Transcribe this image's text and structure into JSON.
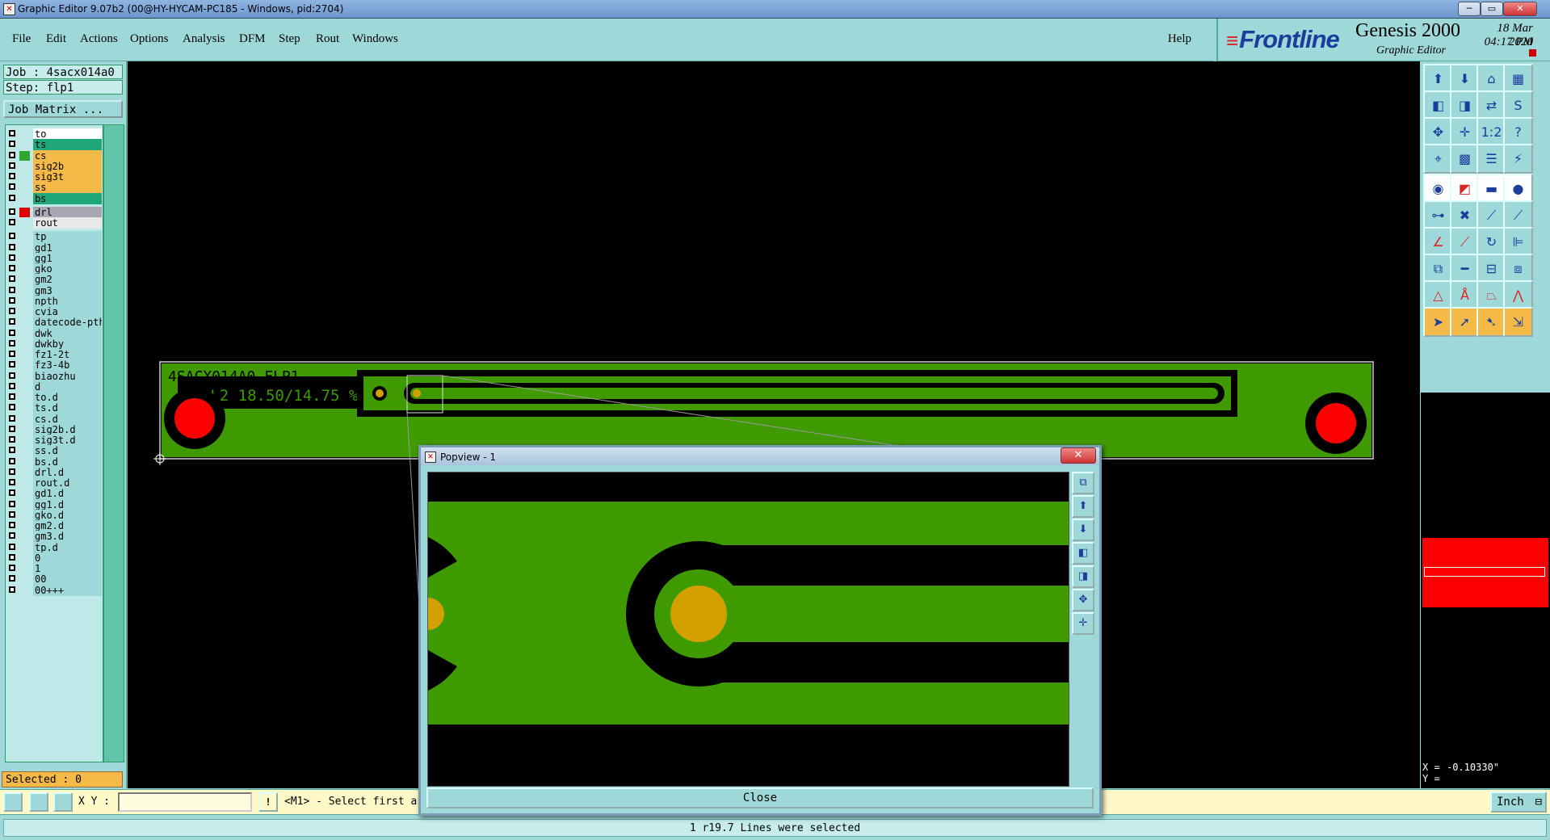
{
  "window": {
    "title": "Graphic Editor 9.07b2 (00@HY-HYCAM-PC185 - Windows, pid:2704)",
    "minimize_icon": "minimize-icon",
    "maximize_icon": "maximize-icon",
    "close_icon": "close-icon",
    "min_label": "─",
    "max_label": "▭",
    "close_label": "✕"
  },
  "menu": [
    "File",
    "Edit",
    "Actions",
    "Options",
    "Analysis",
    "DFM",
    "Step",
    "Rout",
    "Windows"
  ],
  "help_label": "Help",
  "brand": {
    "logo": "Frontline",
    "product": "Genesis 2000",
    "subtitle": "Graphic Editor",
    "date": "18 Mar 2020",
    "time": "04:17 PM"
  },
  "job": {
    "job_label": "Job : 4sacx014a0",
    "step_label": "Step: flp1",
    "job_matrix_button": "Job Matrix ..."
  },
  "layers": [
    {
      "name": "to",
      "color": "#ffffff",
      "swatch": ""
    },
    {
      "name": "ts",
      "color": "#1fa67a",
      "swatch": ""
    },
    {
      "name": "cs",
      "color": "#f5b947",
      "swatch": "#2fa82f"
    },
    {
      "name": "sig2b",
      "color": "#f5b947",
      "swatch": ""
    },
    {
      "name": "sig3t",
      "color": "#f5b947",
      "swatch": ""
    },
    {
      "name": "ss",
      "color": "#f5b947",
      "swatch": ""
    },
    {
      "name": "bs",
      "color": "#1fa67a",
      "swatch": ""
    },
    {
      "name": "drl",
      "color": "#a8a8b4",
      "swatch": "#e00000"
    },
    {
      "name": "rout",
      "color": "#e8e8e8",
      "swatch": ""
    },
    {
      "name": "tp",
      "color": "#9fd8d8",
      "swatch": ""
    },
    {
      "name": "gd1",
      "color": "#9fd8d8",
      "swatch": ""
    },
    {
      "name": "gg1",
      "color": "#9fd8d8",
      "swatch": ""
    },
    {
      "name": "gko",
      "color": "#9fd8d8",
      "swatch": ""
    },
    {
      "name": "gm2",
      "color": "#9fd8d8",
      "swatch": ""
    },
    {
      "name": "gm3",
      "color": "#9fd8d8",
      "swatch": ""
    },
    {
      "name": "npth",
      "color": "#9fd8d8",
      "swatch": ""
    },
    {
      "name": "cvia",
      "color": "#9fd8d8",
      "swatch": ""
    },
    {
      "name": "datecode-pth",
      "color": "#9fd8d8",
      "swatch": ""
    },
    {
      "name": "dwk",
      "color": "#9fd8d8",
      "swatch": ""
    },
    {
      "name": "dwkby",
      "color": "#9fd8d8",
      "swatch": ""
    },
    {
      "name": "fz1-2t",
      "color": "#9fd8d8",
      "swatch": ""
    },
    {
      "name": "fz3-4b",
      "color": "#9fd8d8",
      "swatch": ""
    },
    {
      "name": "biaozhu",
      "color": "#9fd8d8",
      "swatch": ""
    },
    {
      "name": "d",
      "color": "#9fd8d8",
      "swatch": ""
    },
    {
      "name": "to.d",
      "color": "#9fd8d8",
      "swatch": ""
    },
    {
      "name": "ts.d",
      "color": "#9fd8d8",
      "swatch": ""
    },
    {
      "name": "cs.d",
      "color": "#9fd8d8",
      "swatch": ""
    },
    {
      "name": "sig2b.d",
      "color": "#9fd8d8",
      "swatch": ""
    },
    {
      "name": "sig3t.d",
      "color": "#9fd8d8",
      "swatch": ""
    },
    {
      "name": "ss.d",
      "color": "#9fd8d8",
      "swatch": ""
    },
    {
      "name": "bs.d",
      "color": "#9fd8d8",
      "swatch": ""
    },
    {
      "name": "drl.d",
      "color": "#9fd8d8",
      "swatch": ""
    },
    {
      "name": "rout.d",
      "color": "#9fd8d8",
      "swatch": ""
    },
    {
      "name": "gd1.d",
      "color": "#9fd8d8",
      "swatch": ""
    },
    {
      "name": "gg1.d",
      "color": "#9fd8d8",
      "swatch": ""
    },
    {
      "name": "gko.d",
      "color": "#9fd8d8",
      "swatch": ""
    },
    {
      "name": "gm2.d",
      "color": "#9fd8d8",
      "swatch": ""
    },
    {
      "name": "gm3.d",
      "color": "#9fd8d8",
      "swatch": ""
    },
    {
      "name": "tp.d",
      "color": "#9fd8d8",
      "swatch": ""
    },
    {
      "name": "0",
      "color": "#9fd8d8",
      "swatch": ""
    },
    {
      "name": "1",
      "color": "#9fd8d8",
      "swatch": ""
    },
    {
      "name": "00",
      "color": "#9fd8d8",
      "swatch": ""
    },
    {
      "name": "00+++",
      "color": "#9fd8d8",
      "swatch": ""
    }
  ],
  "selected_label": "Selected : 0",
  "board": {
    "silk_line1": "4SACX014A0 FLP1",
    "silk_line2": "L1_L2 18.50/14.75 %",
    "board_color": "#3f9a00",
    "pad_color": "#d4a000",
    "hole_color": "#ff0000"
  },
  "toolbar_icons": [
    "open-icon",
    "save-icon",
    "home-icon",
    "window-split-icon",
    "pan-left-icon",
    "pan-right-icon",
    "mirror-icon",
    "snap-icon",
    "zoom-fit-icon",
    "zoom-center-icon",
    "scale-1-2-icon",
    "help-question-icon",
    "measure-icon",
    "grid-icon",
    "layer-stack-icon",
    "net-icon",
    "camera-icon",
    "edit-red-icon",
    "ruler-icon",
    "dot-icon",
    "connect-icon",
    "delete-icon",
    "move-node-icon",
    "extend-icon",
    "draw-angle-icon",
    "draw-line-icon",
    "arc-icon",
    "route-icon",
    "copy-icon",
    "cut-line-icon",
    "align-icon",
    "group-icon",
    "triangle-icon",
    "triangle-a-icon",
    "trapezoid-icon",
    "fan-icon",
    "pointer-icon",
    "select-arrow-icon",
    "select-pointer-icon",
    "multi-select-icon"
  ],
  "coordinates": {
    "x_label": "X =",
    "y_label": "Y =",
    "x_value": "-0.10330\""
  },
  "input_bar": {
    "xy_label": "X Y :",
    "xy_value": "",
    "prompt": "<M1> - Select first area",
    "units": "Inch"
  },
  "status_message": "1 r19.7 Lines were selected",
  "popview": {
    "title": "Popview - 1",
    "close_label": "Close",
    "x_label": "✕",
    "tools": [
      "popview-fit-icon",
      "popview-up-icon",
      "popview-down-icon",
      "popview-left-icon",
      "popview-right-icon",
      "popview-zoom-in-icon",
      "popview-zoom-out-icon"
    ]
  }
}
